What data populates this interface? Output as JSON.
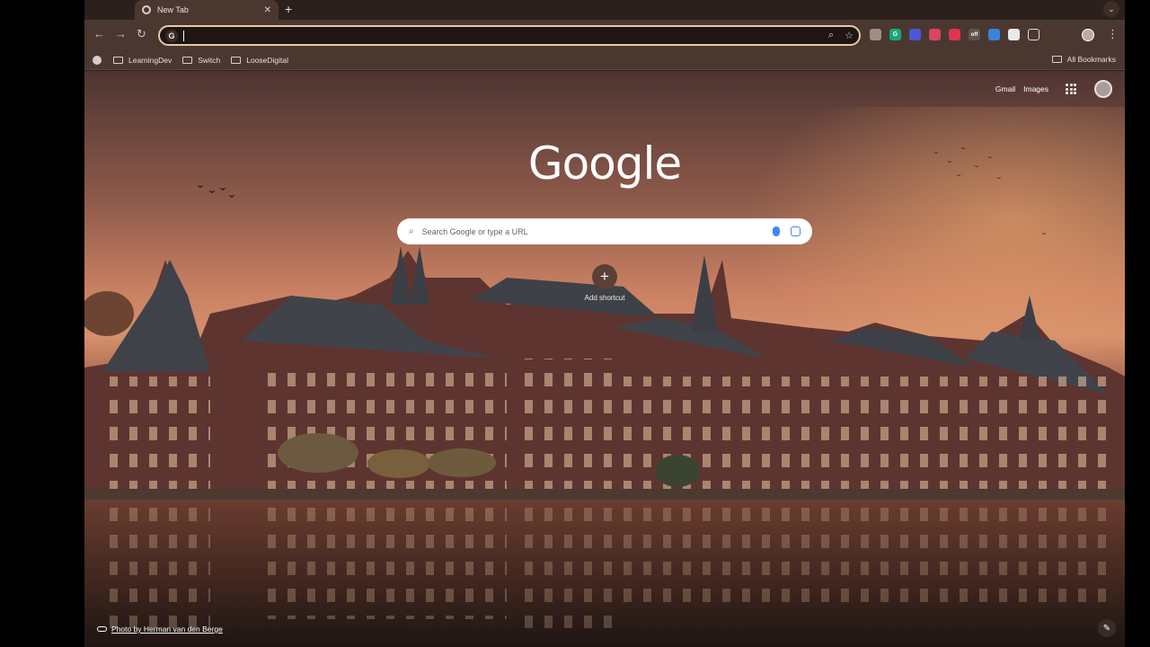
{
  "tab": {
    "title": "New Tab",
    "close": "✕",
    "new_tab": "+",
    "search_tabs": "⌄"
  },
  "toolbar": {
    "back": "←",
    "forward": "→",
    "reload": "↻",
    "omnibox_value": "",
    "extensions": [
      {
        "name": "ext-1-icon",
        "color": "#9e8e86",
        "glyph": ""
      },
      {
        "name": "grammarly-icon",
        "color": "#15a87a",
        "glyph": "G"
      },
      {
        "name": "ext-3-icon",
        "color": "#4a57d8",
        "glyph": ""
      },
      {
        "name": "ext-4-icon",
        "color": "#d94560",
        "glyph": ""
      },
      {
        "name": "ext-5-icon",
        "color": "#e0344d",
        "glyph": ""
      },
      {
        "name": "ext-off-icon",
        "color": "#5d5550",
        "glyph": "off"
      },
      {
        "name": "ext-7-icon",
        "color": "#3b82e0",
        "glyph": ""
      },
      {
        "name": "ext-8-icon",
        "color": "#eaeaea",
        "glyph": ""
      }
    ]
  },
  "bookmarks": {
    "items": [
      "LearningDev",
      "Switch",
      "LooseDigital"
    ],
    "all": "All Bookmarks"
  },
  "ntp": {
    "links": [
      "Gmail",
      "Images"
    ],
    "logo": "Google",
    "search_placeholder": "Search Google or type a URL",
    "add_shortcut": "Add shortcut",
    "photo_credit": "Photo by Herman van den Berge"
  },
  "colors": {
    "frame": "#4a3830",
    "accent_outline": "#e7c9a6"
  }
}
